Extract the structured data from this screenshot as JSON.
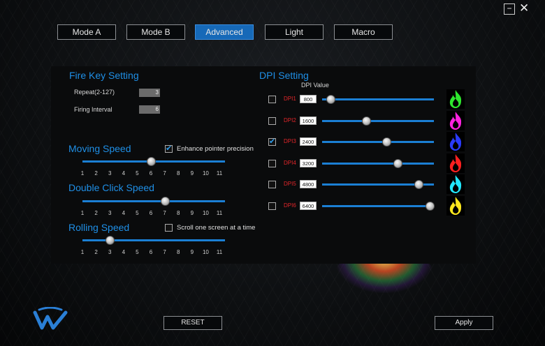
{
  "window": {
    "minimize_glyph": "−",
    "close_glyph": "✕"
  },
  "tabs": [
    {
      "label": "Mode A",
      "active": false
    },
    {
      "label": "Mode B",
      "active": false
    },
    {
      "label": "Advanced",
      "active": true
    },
    {
      "label": "Light",
      "active": false
    },
    {
      "label": "Macro",
      "active": false
    }
  ],
  "fire_key": {
    "title": "Fire Key Setting",
    "repeat_label": "Repeat(2-127)",
    "repeat_value": "3",
    "interval_label": "Firing Interval",
    "interval_value": "6"
  },
  "moving_speed": {
    "title": "Moving Speed",
    "enhance_label": "Enhance pointer precision",
    "enhance_checked": true,
    "level": 6
  },
  "double_click": {
    "title": "Double Click Speed",
    "level": 7
  },
  "rolling_speed": {
    "title": "Rolling Speed",
    "scroll_label": "Scroll one screen at a time",
    "scroll_checked": false,
    "level": 3
  },
  "scale_ticks": [
    "1",
    "2",
    "3",
    "4",
    "5",
    "6",
    "7",
    "8",
    "9",
    "10",
    "11"
  ],
  "dpi": {
    "title": "DPI Setting",
    "value_header": "DPI Value",
    "rows": [
      {
        "label": "DPI1",
        "value": "800",
        "checked": false,
        "level": 0.08,
        "flame_color": "#2ee82e"
      },
      {
        "label": "DPI2",
        "value": "1600",
        "checked": false,
        "level": 0.4,
        "flame_color": "#ff22e0"
      },
      {
        "label": "DPI3",
        "value": "2400",
        "checked": true,
        "level": 0.58,
        "flame_color": "#2a3bff"
      },
      {
        "label": "DPI4",
        "value": "3200",
        "checked": false,
        "level": 0.68,
        "flame_color": "#ff2020"
      },
      {
        "label": "DPI5",
        "value": "4800",
        "checked": false,
        "level": 0.87,
        "flame_color": "#22e8ff"
      },
      {
        "label": "DPI6",
        "value": "6400",
        "checked": false,
        "level": 0.97,
        "flame_color": "#ffe81e"
      }
    ]
  },
  "buttons": {
    "reset": "RESET",
    "apply": "Apply"
  },
  "colors": {
    "accent": "#1f8fe6",
    "active_tab": "#1669b8",
    "dpi_label": "#e3262a"
  }
}
